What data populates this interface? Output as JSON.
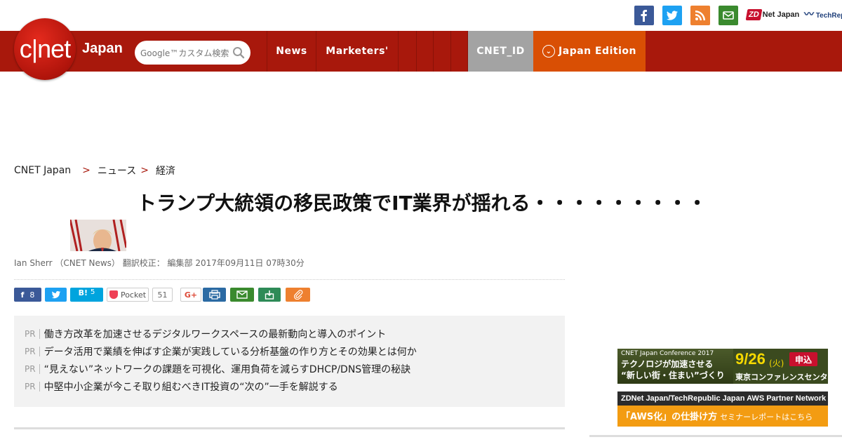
{
  "social": {
    "facebook_icon": "facebook-icon",
    "twitter_icon": "twitter-icon",
    "rss_icon": "rss-icon",
    "mail_icon": "mail-icon",
    "zdnet_logo": "ZD",
    "zdnet_text": "Net Japan",
    "techrepublic_text": "TechRepublic"
  },
  "nav": {
    "logo_text": "c|net",
    "logo_sub": "Japan",
    "search_placeholder": "Google™カスタム検索",
    "items": [
      {
        "label": "News"
      },
      {
        "label": "Marketers'"
      },
      {
        "label": ""
      },
      {
        "label": ""
      },
      {
        "label": ""
      }
    ],
    "cnet_id": "CNET_ID",
    "edition": "Japan Edition",
    "edition_icon": "chevron-down-icon"
  },
  "breadcrumb": {
    "home": "CNET Japan",
    "sep": ">",
    "level1": "ニュース",
    "level2": "経済"
  },
  "article": {
    "headline": "トランプ大統領の移民政策でIT業界が揺れる・・・・・・・・・",
    "byline": "Ian Sherr （CNET News） 翻訳校正： 編集部 2017年09月11日 07時30分"
  },
  "share": {
    "facebook_count": "8",
    "hatena_label": "B!",
    "hatena_count": "5",
    "pocket_label": "Pocket",
    "pocket_count": "51",
    "gplus_label": "G+"
  },
  "pr": {
    "tag": "PR",
    "items": [
      "働き方改革を加速させるデジタルワークスペースの最新動向と導入のポイント",
      "データ活用で業績を伸ばす企業が実践している分析基盤の作り方とその効果とは何か",
      "“見えない”ネットワークの課題を可視化、運用負荷を減らすDHCP/DNS管理の秘訣",
      "中堅中小企業が今こそ取り組むべきIT投資の“次の”一手を解説する"
    ]
  },
  "ads": {
    "ad1": {
      "title": "CNET Japan Conference 2017",
      "main_line1": "テクノロジが加速させる",
      "main_line2": "“新しい街・住まい”づくり",
      "date": "9/26",
      "weekday": "(火)",
      "apply": "申込",
      "venue": "東京コンファレンスセンター"
    },
    "ad2": {
      "title": "ZDNet Japan/TechRepublic Japan  AWS Partner Network",
      "main": "「AWS化」の仕掛け方",
      "sub": "セミナーレポートはこちら"
    }
  }
}
